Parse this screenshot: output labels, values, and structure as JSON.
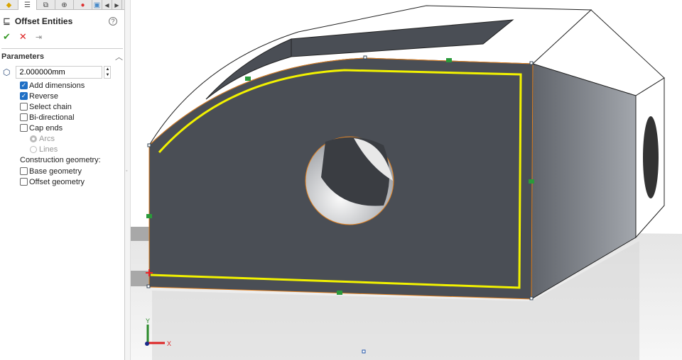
{
  "tabs": [
    {
      "icon": "feature-manager-icon"
    },
    {
      "icon": "property-manager-icon"
    },
    {
      "icon": "configuration-manager-icon"
    },
    {
      "icon": "dimxpert-icon"
    },
    {
      "icon": "appearance-icon"
    },
    {
      "icon": "display-manager-icon"
    }
  ],
  "panel": {
    "title": "Offset Entities",
    "help": "?",
    "ok": "✔",
    "cancel": "✕",
    "pin": "⇥"
  },
  "parameters": {
    "title": "Parameters",
    "distance": "2.000000mm",
    "checkboxes": [
      {
        "label": "Add dimensions",
        "checked": true
      },
      {
        "label": "Reverse",
        "checked": true
      },
      {
        "label": "Select chain",
        "checked": false
      },
      {
        "label": "Bi-directional",
        "checked": false
      },
      {
        "label": "Cap ends",
        "checked": false
      }
    ],
    "radios": [
      {
        "label": "Arcs",
        "selected": true
      },
      {
        "label": "Lines",
        "selected": false
      }
    ],
    "construction_label": "Construction geometry:",
    "construction": [
      {
        "label": "Base geometry",
        "checked": false
      },
      {
        "label": "Offset geometry",
        "checked": false
      }
    ]
  },
  "triad": {
    "x": "X",
    "y": "Y"
  },
  "colors": {
    "offset": "#f2f200",
    "face": "#4a4e55",
    "accent": "#1f6fc5"
  }
}
